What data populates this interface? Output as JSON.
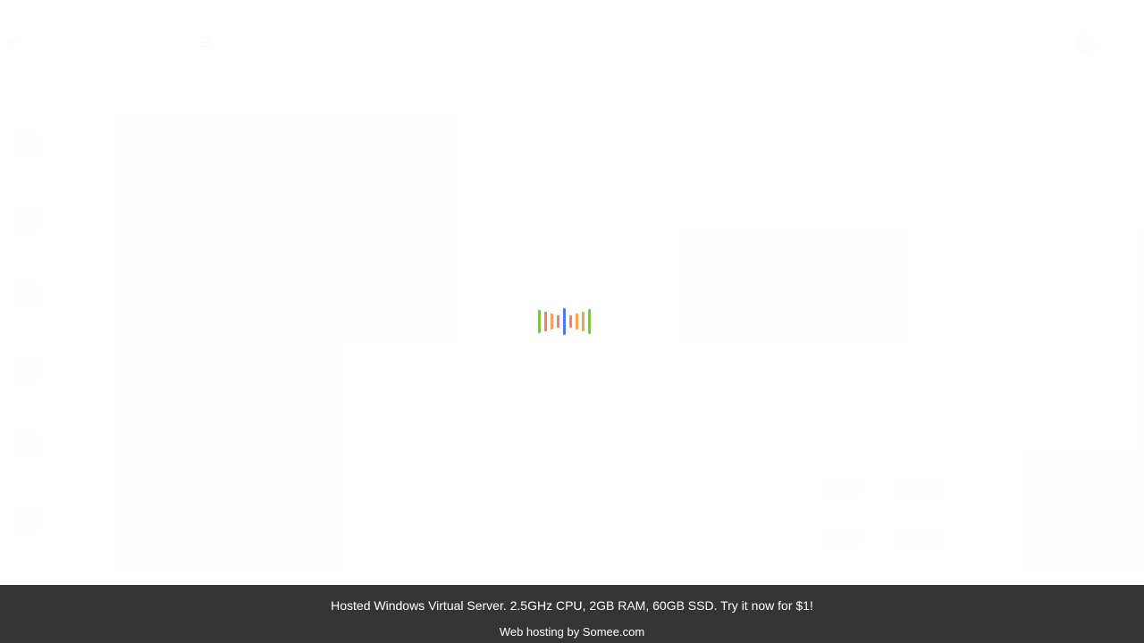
{
  "footer": {
    "ad_text": "Hosted Windows Virtual Server. 2.5GHz CPU, 2GB RAM, 60GB SSD. Try it now for $1!",
    "hosting_text": "Web hosting by Somee.com"
  },
  "loader": {
    "bar_colors": [
      "#7cc24f",
      "#f07f6d",
      "#f4a259",
      "#f07f6d",
      "#4a7cf0",
      "#f07f6d",
      "#f4a259",
      "#f4a259",
      "#7cc24f"
    ]
  }
}
